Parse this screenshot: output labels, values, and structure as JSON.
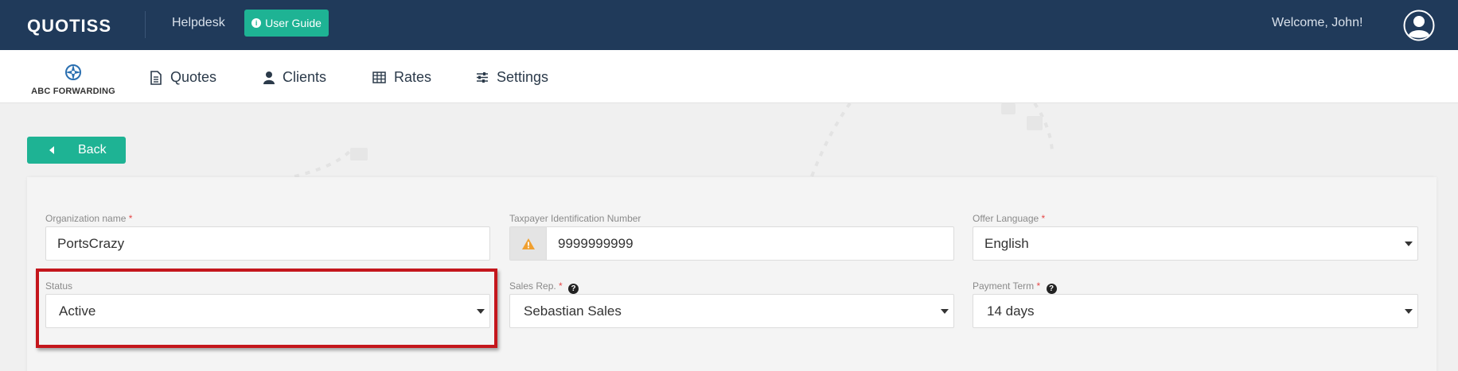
{
  "topbar": {
    "logo": "QUOTISS",
    "helpdesk": "Helpdesk",
    "user_guide": "User Guide",
    "welcome": "Welcome, John!"
  },
  "navbar": {
    "company_name": "ABC FORWARDING",
    "items": [
      {
        "label": "Quotes",
        "icon": "document-icon"
      },
      {
        "label": "Clients",
        "icon": "user-icon"
      },
      {
        "label": "Rates",
        "icon": "table-icon"
      },
      {
        "label": "Settings",
        "icon": "sliders-icon"
      }
    ]
  },
  "actions": {
    "back": "Back"
  },
  "form": {
    "organization_name": {
      "label": "Organization name",
      "required": "*",
      "value": "PortsCrazy"
    },
    "tax_id": {
      "label": "Taxpayer Identification Number",
      "value": "9999999999"
    },
    "offer_language": {
      "label": "Offer Language",
      "required": "*",
      "value": "English"
    },
    "status": {
      "label": "Status",
      "value": "Active"
    },
    "sales_rep": {
      "label": "Sales Rep.",
      "required": "*",
      "value": "Sebastian Sales"
    },
    "payment_term": {
      "label": "Payment Term",
      "required": "*",
      "value": "14 days"
    }
  },
  "colors": {
    "topbar": "#203a5a",
    "accent": "#1eb394",
    "required": "#e54848",
    "warning": "#f0a030",
    "highlight": "#c4161c"
  }
}
